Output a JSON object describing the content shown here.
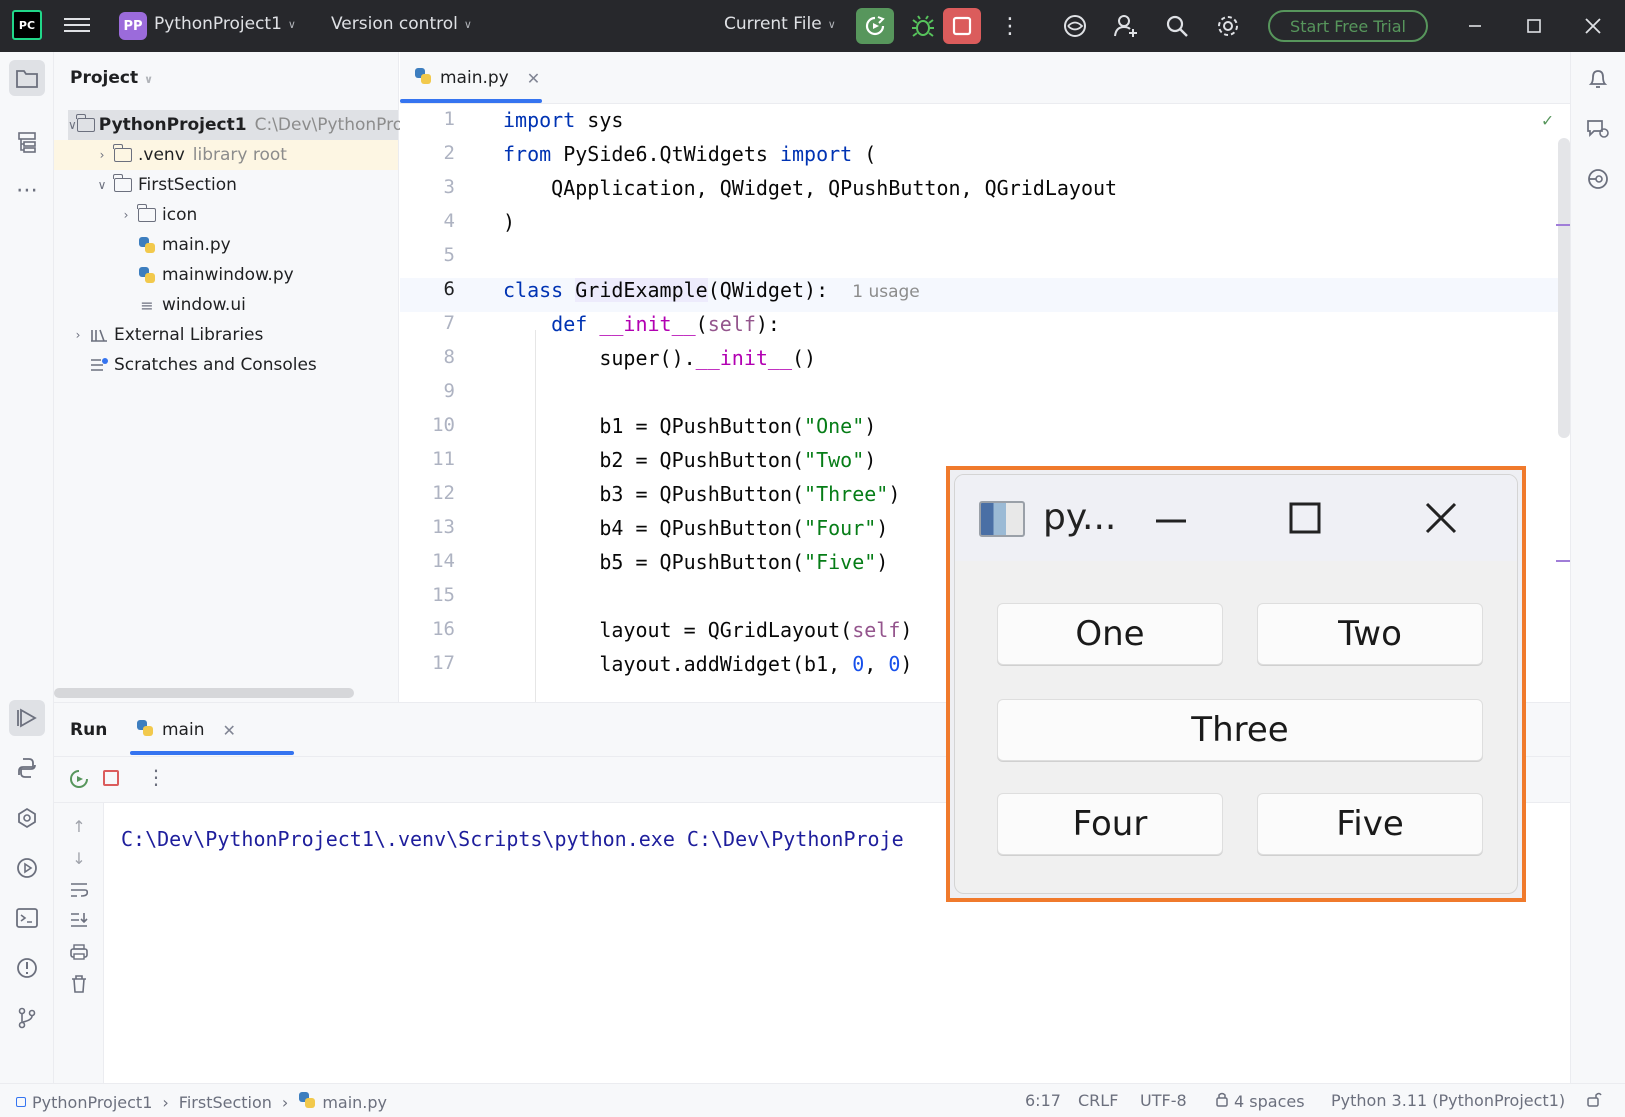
{
  "titlebar": {
    "logo_text": "PC",
    "project_badge": "PP",
    "project_name": "PythonProject1",
    "version_control": "Version control",
    "run_config": "Current File",
    "trial_button": "Start Free Trial",
    "icons": [
      "hamburger-icon",
      "run-icon",
      "debug-icon",
      "stop-icon",
      "more-icon",
      "ai-assistant-icon",
      "add-user-icon",
      "search-icon",
      "gear-icon",
      "minimize-icon",
      "maximize-icon",
      "close-icon"
    ]
  },
  "project_panel": {
    "title": "Project",
    "tree": [
      {
        "label": "PythonProject1",
        "hint": "C:\\Dev\\PythonProj",
        "depth": 0
      },
      {
        "label": ".venv",
        "hint": "library root",
        "depth": 1
      },
      {
        "label": "FirstSection",
        "hint": "",
        "depth": 1
      },
      {
        "label": "icon",
        "hint": "",
        "depth": 2
      },
      {
        "label": "main.py",
        "hint": "",
        "depth": 2
      },
      {
        "label": "mainwindow.py",
        "hint": "",
        "depth": 2
      },
      {
        "label": "window.ui",
        "hint": "",
        "depth": 2
      },
      {
        "label": "External Libraries",
        "hint": "",
        "depth": 0
      },
      {
        "label": "Scratches and Consoles",
        "hint": "",
        "depth": 0
      }
    ]
  },
  "editor": {
    "tab_label": "main.py",
    "line_numbers": [
      "1",
      "2",
      "3",
      "4",
      "5",
      "6",
      "7",
      "8",
      "9",
      "10",
      "11",
      "12",
      "13",
      "14",
      "15",
      "16",
      "17"
    ],
    "usage_hint": "1 usage",
    "lines": {
      "l1": [
        "import",
        " sys"
      ],
      "l2": [
        "from",
        " PySide6.QtWidgets ",
        "import",
        " ("
      ],
      "l3": "    QApplication, QWidget, QPushButton, QGridLayout",
      "l4": ")",
      "l6": [
        "class",
        " ",
        "GridExample",
        "(QWidget):"
      ],
      "l7": [
        "    ",
        "def",
        " ",
        "__init__",
        "(",
        "self",
        "):"
      ],
      "l8": [
        "        super().",
        "__init__",
        "()"
      ],
      "l10": [
        "        b1 = QPushButton(",
        "\"One\"",
        ")"
      ],
      "l11": [
        "        b2 = QPushButton(",
        "\"Two\"",
        ")"
      ],
      "l12": [
        "        b3 = QPushButton(",
        "\"Three\"",
        ")"
      ],
      "l13": [
        "        b4 = QPushButton(",
        "\"Four\"",
        ")"
      ],
      "l14": [
        "        b5 = QPushButton(",
        "\"Five\"",
        ")"
      ],
      "l16": [
        "        layout = QGridLayout(",
        "self",
        ")"
      ],
      "l17": [
        "        layout.addWidget(b1, ",
        "0",
        ", ",
        "0",
        ")"
      ]
    }
  },
  "run_panel": {
    "title": "Run",
    "tab_label": "main",
    "console_line": "C:\\Dev\\PythonProject1\\.venv\\Scripts\\python.exe C:\\Dev\\PythonProje"
  },
  "qt_window": {
    "title": "py...",
    "buttons": [
      "One",
      "Two",
      "Three",
      "Four",
      "Five"
    ]
  },
  "statusbar": {
    "breadcrumb": [
      "PythonProject1",
      "FirstSection",
      "main.py"
    ],
    "position": "6:17",
    "line_sep": "CRLF",
    "encoding": "UTF-8",
    "indent": "4 spaces",
    "interpreter": "Python 3.11 (PythonProject1)"
  },
  "colors": {
    "accent": "#3574f0",
    "run_green": "#57965c",
    "stop_red": "#db5c5c",
    "highlight_border": "#f07a2c"
  }
}
